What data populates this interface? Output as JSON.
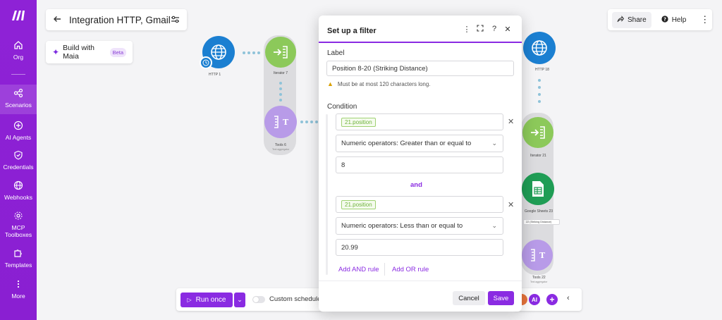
{
  "colors": {
    "brand": "#8a2be2",
    "sidebar": "#8e22d6",
    "http_node": "#1b7fd1",
    "iterator_node": "#8cc95a",
    "tools_node": "#b89be8",
    "sheets_node": "#1f9d55"
  },
  "sidebar": {
    "items": [
      {
        "label": "Org",
        "icon": "home-icon"
      },
      {
        "label": "Scenarios",
        "icon": "share-nodes-icon"
      },
      {
        "label": "AI Agents",
        "icon": "ai-agent-icon"
      },
      {
        "label": "Credentials",
        "icon": "shield-icon"
      },
      {
        "label": "Webhooks",
        "icon": "globe-icon"
      },
      {
        "label": "MCP Toolboxes",
        "icon": "mcp-icon"
      },
      {
        "label": "Templates",
        "icon": "puzzle-icon"
      },
      {
        "label": "More",
        "icon": "more-vertical-icon"
      }
    ]
  },
  "header": {
    "title": "Integration HTTP, Gmail"
  },
  "maia": {
    "label": "Build with Maia",
    "badge": "Beta"
  },
  "topright": {
    "share": "Share",
    "help": "Help"
  },
  "canvas": {
    "nodes": [
      {
        "label": "HTTP",
        "num": "1"
      },
      {
        "label": "Iterator",
        "num": "7"
      },
      {
        "label": "Tools",
        "num": "6",
        "sub": "Text aggregator"
      },
      {
        "label": "HTTP",
        "num": "18"
      },
      {
        "label": "Iterator",
        "num": "21"
      },
      {
        "label": "Google Sheets",
        "num": "23"
      },
      {
        "label": "Tools",
        "num": "22",
        "sub": "Text aggregator"
      }
    ],
    "filter_tag": "22 (Striking Distance)"
  },
  "toolbar": {
    "run_label": "Run once",
    "schedule_label": "Custom schedule"
  },
  "rightbar": {
    "ai_label": "AI"
  },
  "modal": {
    "title": "Set up a filter",
    "label_heading": "Label",
    "label_value": "Position 8-20 (Striking Distance)",
    "hint": "Must be at most 120 characters long.",
    "condition_heading": "Condition",
    "rules": [
      {
        "field": "21.position",
        "operator": "Numeric operators: Greater than or equal to",
        "value": "8"
      },
      {
        "field": "21.position",
        "operator": "Numeric operators: Less than or equal to",
        "value": "20.99"
      }
    ],
    "and_label": "and",
    "add_and": "Add AND rule",
    "add_or": "Add OR rule",
    "cancel": "Cancel",
    "save": "Save"
  }
}
